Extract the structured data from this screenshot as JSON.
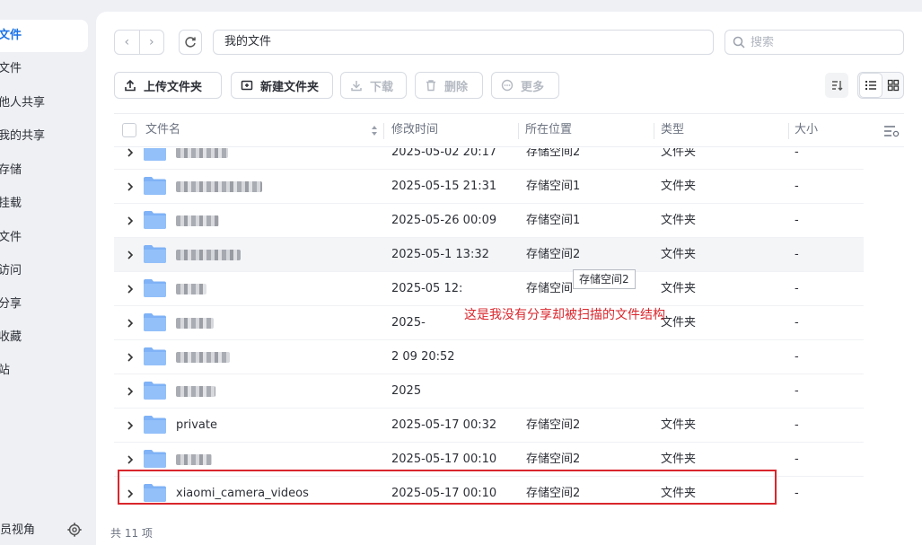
{
  "sidebar": {
    "items": [
      {
        "label": "文件",
        "active": true
      },
      {
        "label": "文件"
      },
      {
        "label": "他人共享"
      },
      {
        "label": "我的共享"
      },
      {
        "label": "存储"
      },
      {
        "label": "挂载"
      },
      {
        "label": "文件"
      },
      {
        "label": "访问"
      },
      {
        "label": "分享"
      },
      {
        "label": "收藏"
      },
      {
        "label": "站"
      }
    ],
    "footer_label": "员视角",
    "settings_icon": "gear-icon"
  },
  "toolbar": {
    "path": "我的文件",
    "search_placeholder": "搜索",
    "upload_folder": "上传文件夹",
    "new_folder": "新建文件夹",
    "download": "下载",
    "delete": "删除",
    "more": "更多"
  },
  "table": {
    "headers": {
      "name": "文件名",
      "modified": "修改时间",
      "location": "所在位置",
      "type": "类型",
      "size": "大小"
    },
    "rows": [
      {
        "name": "",
        "modified": "2025-05-02 20:17",
        "location": "存储空间2",
        "type": "文件夹",
        "size": "-",
        "obscured": true
      },
      {
        "name": "",
        "modified": "2025-05-15 21:31",
        "location": "存储空间1",
        "type": "文件夹",
        "size": "-",
        "obscured": true
      },
      {
        "name": "",
        "modified": "2025-05-26 00:09",
        "location": "存储空间1",
        "type": "文件夹",
        "size": "-",
        "obscured": true
      },
      {
        "name": "",
        "modified": "2025-05-1 13:32",
        "location": "存储空间2",
        "type": "文件夹",
        "size": "-",
        "obscured": true,
        "hover": true
      },
      {
        "name": "",
        "modified": "2025-05 12:",
        "location": "存储空间",
        "type": "文件夹",
        "size": "-",
        "obscured": true
      },
      {
        "name": "",
        "modified": "2025-",
        "location": "",
        "type": "文件夹",
        "size": "-",
        "obscured": true
      },
      {
        "name": "",
        "modified": "2 09 20:52",
        "location": "",
        "type": "",
        "size": "-",
        "obscured": true
      },
      {
        "name": "",
        "modified": "2025",
        "location": "",
        "type": "",
        "size": "-",
        "obscured": true
      },
      {
        "name": "private",
        "modified": "2025-05-17 00:32",
        "location": "存储空间2",
        "type": "文件夹",
        "size": "-"
      },
      {
        "name": "",
        "modified": "2025-05-17 00:10",
        "location": "存储空间2",
        "type": "文件夹",
        "size": "-",
        "obscured": true
      },
      {
        "name": "xiaomi_camera_videos",
        "modified": "2025-05-17 00:10",
        "location": "存储空间2",
        "type": "文件夹",
        "size": "-",
        "highlighted": true
      }
    ]
  },
  "tooltip": "存储空间2",
  "annotation": "这是我没有分享却被扫描的文件结构",
  "footer": {
    "count": "共 11 项"
  },
  "colors": {
    "accent": "#1a73e8",
    "folder": "#7fb2f6",
    "annotation": "#d9262c"
  }
}
